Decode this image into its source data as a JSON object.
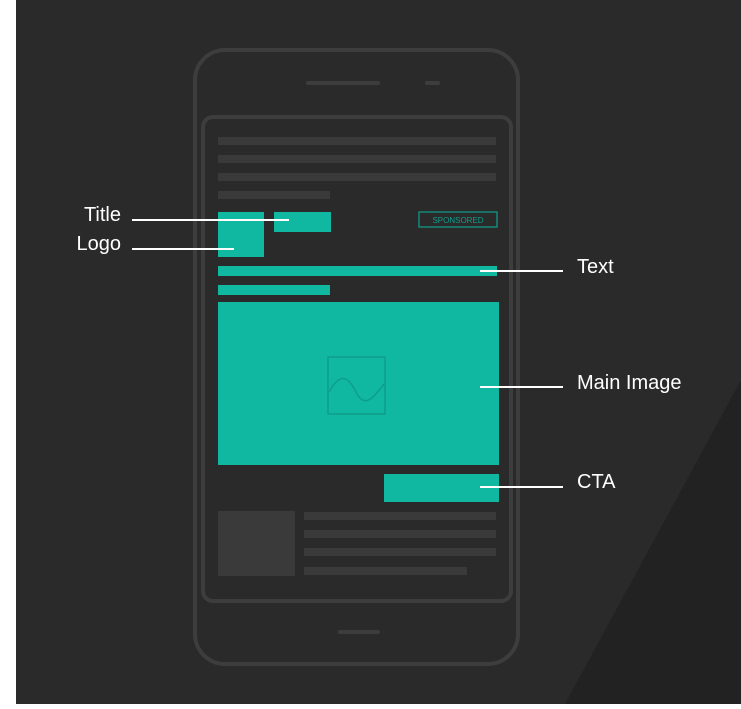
{
  "diagram": {
    "sponsored_badge": "SPONSORED",
    "callouts": {
      "title": "Title",
      "logo": "Logo",
      "text": "Text",
      "main_image": "Main Image",
      "cta": "CTA"
    }
  },
  "colors": {
    "background": "#2a2a2a",
    "phone_outline": "#3d3d3d",
    "placeholder_gray": "#3a3a3a",
    "accent_teal": "#11b8a1",
    "label_white": "#ffffff"
  }
}
